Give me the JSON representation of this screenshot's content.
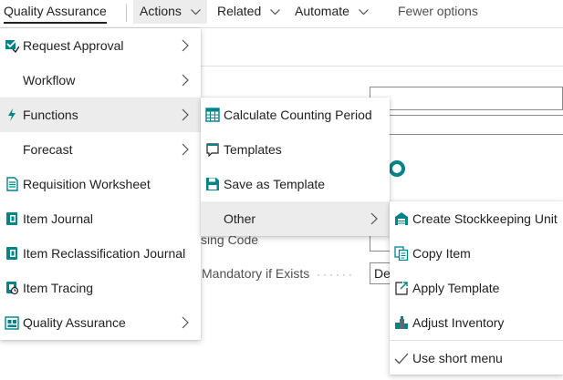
{
  "actionbar": {
    "quality_assurance": "Quality Assurance",
    "actions": "Actions",
    "related": "Related",
    "automate": "Automate",
    "fewer_options": "Fewer options"
  },
  "background": {
    "field_label_fragment": "sing Code",
    "field_label_mandatory": "Mandatory if Exists",
    "field_value_fragment": "De"
  },
  "menu_main": {
    "items": [
      {
        "label": "Request Approval",
        "icon": "approval-icon",
        "submenu": true
      },
      {
        "label": "Workflow",
        "icon": "",
        "submenu": true
      },
      {
        "label": "Functions",
        "icon": "lightning-icon",
        "submenu": true,
        "highlighted": true
      },
      {
        "label": "Forecast",
        "icon": "",
        "submenu": true
      },
      {
        "label": "Requisition Worksheet",
        "icon": "worksheet-icon",
        "submenu": false
      },
      {
        "label": "Item Journal",
        "icon": "journal-icon",
        "submenu": false
      },
      {
        "label": "Item Reclassification Journal",
        "icon": "journal-icon",
        "submenu": false
      },
      {
        "label": "Item Tracing",
        "icon": "tracing-icon",
        "submenu": false
      },
      {
        "label": "Quality Assurance",
        "icon": "quality-assurance-icon",
        "submenu": true
      }
    ]
  },
  "menu_functions": {
    "items": [
      {
        "label": "Calculate Counting Period",
        "icon": "calendar-grid-icon",
        "submenu": false
      },
      {
        "label": "Templates",
        "icon": "template-icon",
        "submenu": false
      },
      {
        "label": "Save as Template",
        "icon": "save-icon",
        "submenu": false
      },
      {
        "label": "Other",
        "icon": "",
        "submenu": true,
        "highlighted": true
      }
    ]
  },
  "menu_other": {
    "items": [
      {
        "label": "Create Stockkeeping Unit",
        "icon": "warehouse-icon"
      },
      {
        "label": "Copy Item",
        "icon": "copy-icon"
      },
      {
        "label": "Apply Template",
        "icon": "apply-template-icon"
      },
      {
        "label": "Adjust Inventory",
        "icon": "inventory-icon"
      },
      {
        "label": "Use short menu",
        "icon": "checkmark-icon"
      }
    ]
  },
  "colors": {
    "accent_teal": "#008489",
    "highlight_bg": "#ececec",
    "text": "#212121"
  }
}
